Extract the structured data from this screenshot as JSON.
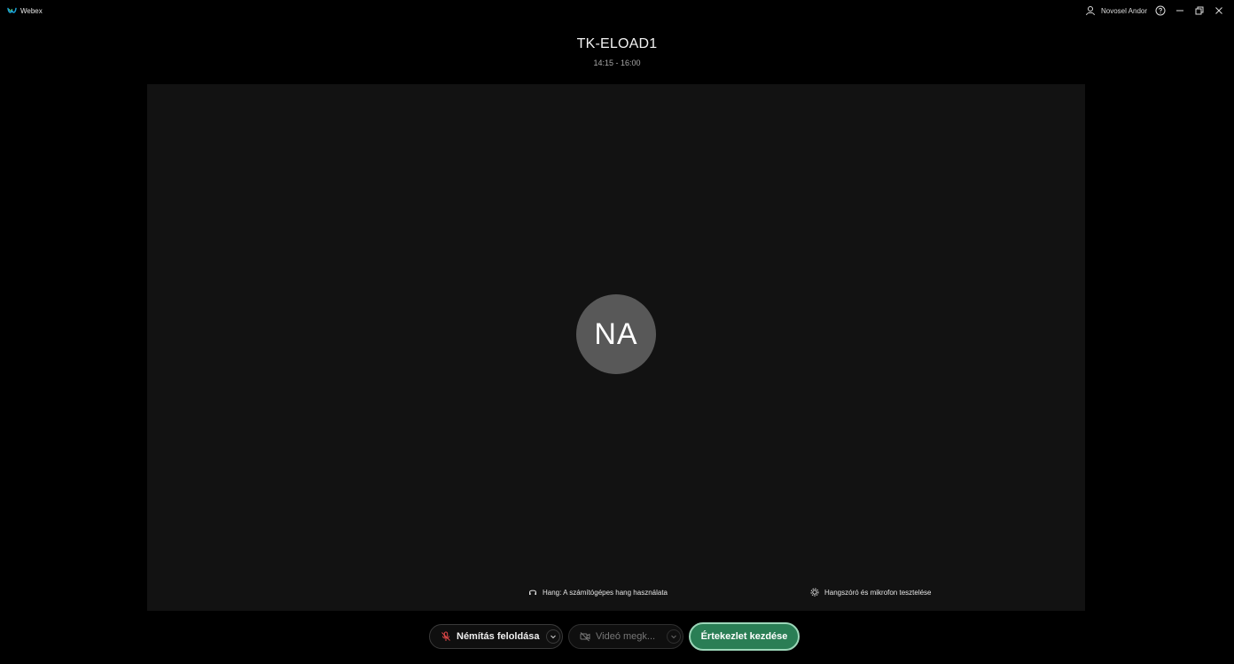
{
  "app": {
    "name": "Webex",
    "brand_color": "#1aa2d9"
  },
  "titlebar": {
    "user_name": "Novosel Andor",
    "icons": [
      "user-icon",
      "help-icon",
      "minimize-icon",
      "restore-icon",
      "close-icon"
    ]
  },
  "meeting": {
    "title": "TK-ELOAD1",
    "time": "14:15 - 16:00"
  },
  "preview": {
    "avatar_initials": "NA",
    "audio_label": "Hang: A számítógépes hang használata",
    "test_label": "Hangszóró és mikrofon tesztelése"
  },
  "controls": {
    "mute_label": "Némítás feloldása",
    "video_label": "Videó megk...",
    "start_label": "Értekezlet kezdése",
    "accent_color": "#2a7e55",
    "mute_icon_color": "#e04848"
  }
}
